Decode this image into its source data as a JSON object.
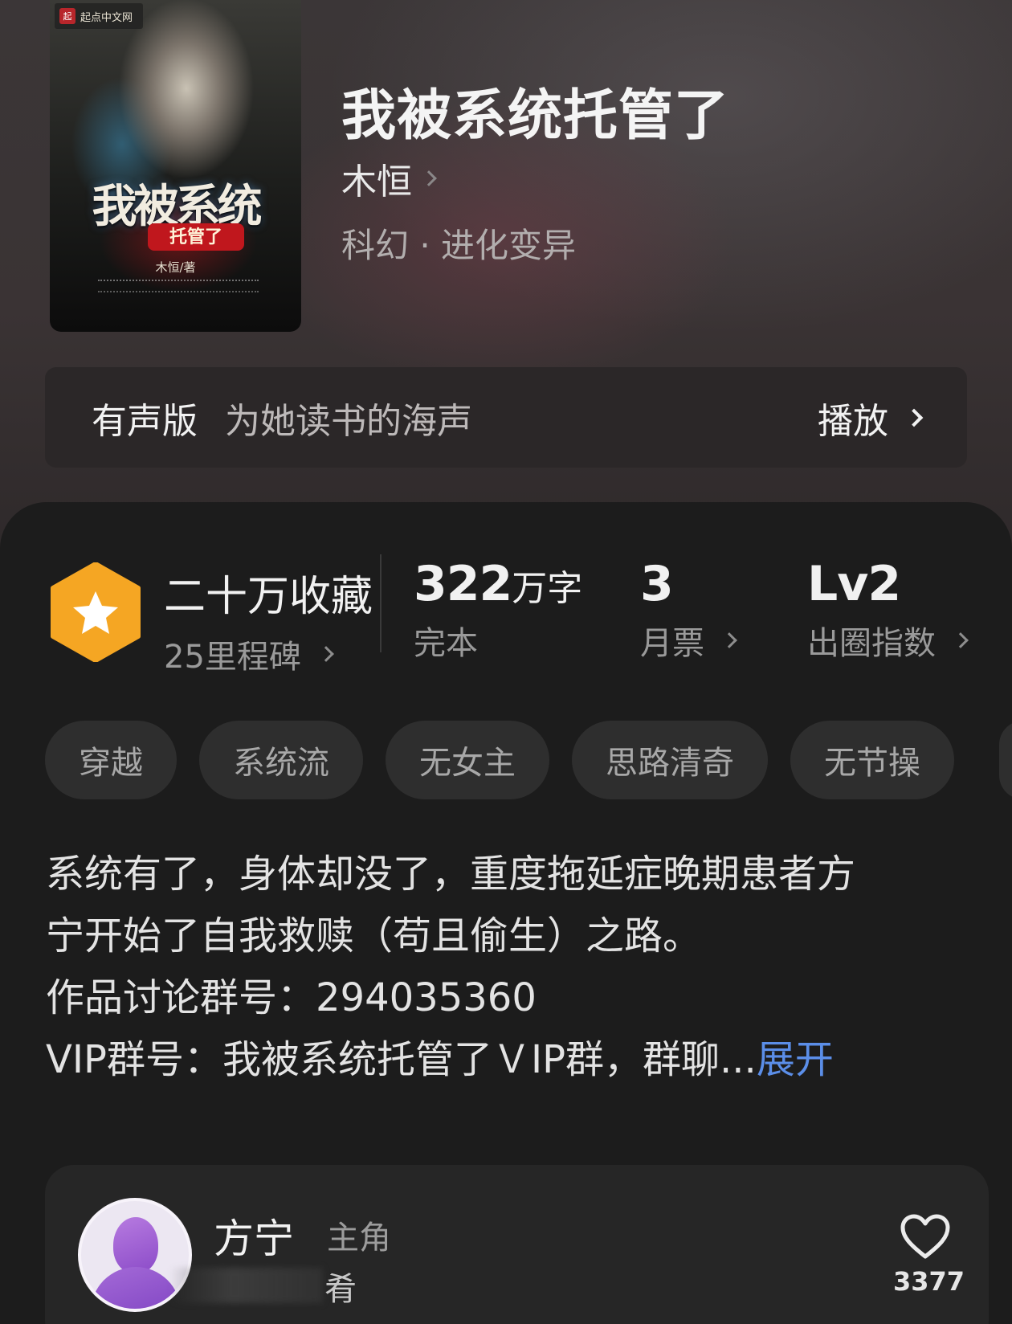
{
  "book": {
    "title": "我被系统托管了",
    "author": "木恒",
    "genre": "科幻 · 进化变异",
    "cover": {
      "publisher": "起点中文网",
      "publisher_mark": "起",
      "title": "我被系统",
      "subtitle": "托管了",
      "author_credit": "木恒/著"
    }
  },
  "audio": {
    "label": "有声版",
    "narrator": "为她读书的海声",
    "play_label": "播放"
  },
  "stats": {
    "collection": {
      "title": "二十万收藏",
      "sub": "25里程碑"
    },
    "words": {
      "value": "322",
      "unit": "万字",
      "sub": "完本"
    },
    "monthly_ticket": {
      "value": "3",
      "sub": "月票"
    },
    "index": {
      "value": "Lv2",
      "sub": "出圈指数"
    }
  },
  "tags": [
    "穿越",
    "系统流",
    "无女主",
    "思路清奇",
    "无节操"
  ],
  "description": {
    "line1": "系统有了，身体却没了，重度拖延症晚期患者方",
    "line2": "宁开始了自我救赎（苟且偷生）之路。",
    "line3": "作品讨论群号：294035360",
    "line4": "VIP群号：我被系统托管了ＶIP群，群聊...",
    "expand_label": "展开"
  },
  "character": {
    "name": "方宁",
    "role": "主角",
    "snippet": "肴",
    "likes": "3377"
  },
  "colors": {
    "accent_link": "#5b8ee8",
    "badge_orange": "#f5a623"
  }
}
